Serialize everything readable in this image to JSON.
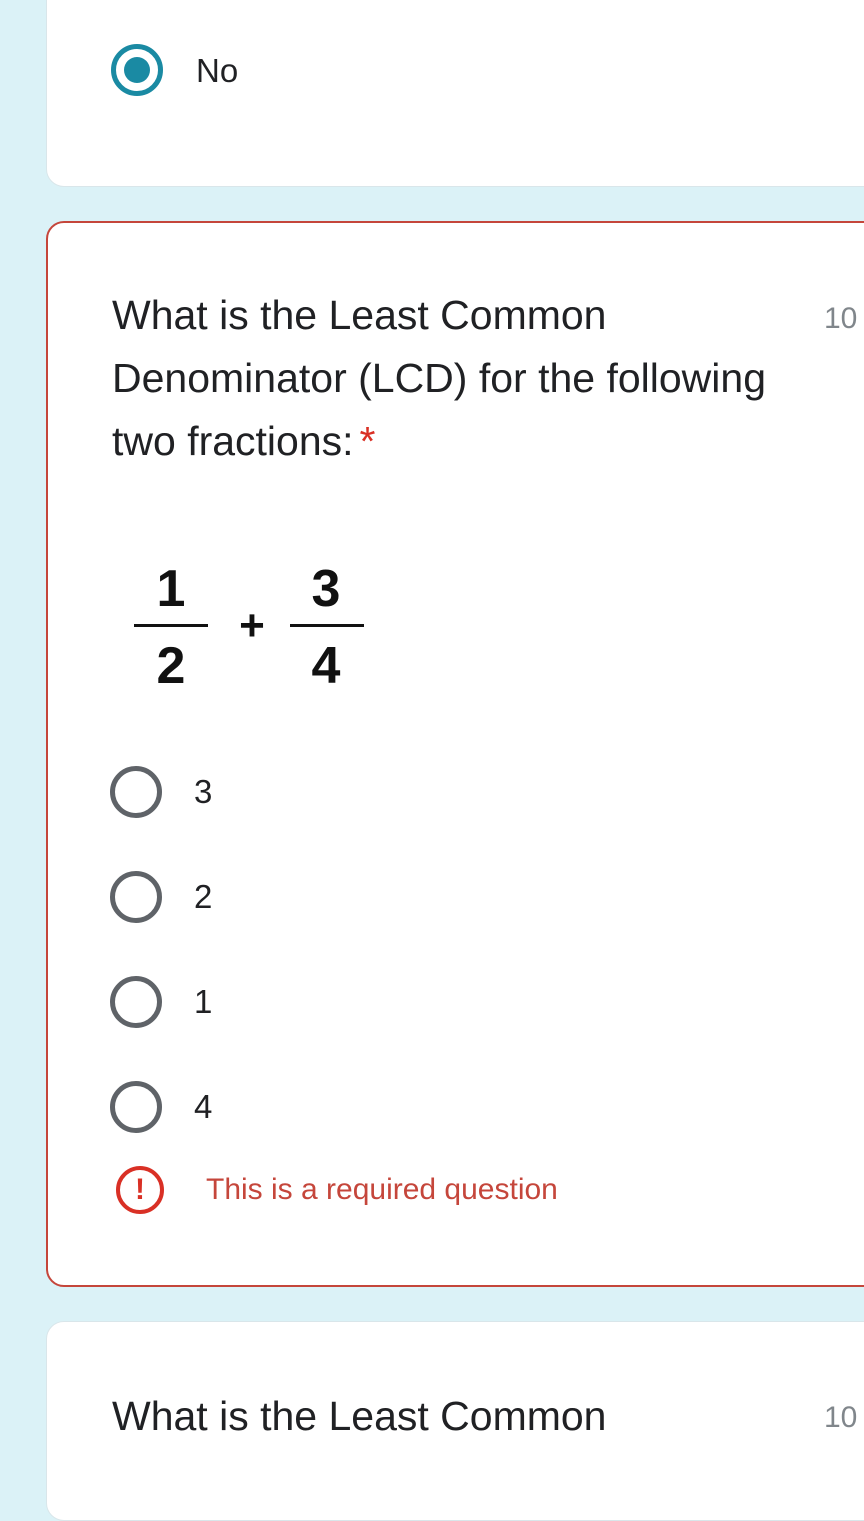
{
  "previous_question": {
    "selected_option": "No"
  },
  "question": {
    "title": "What is the Least Common Denominator (LCD) for the following two fractions:",
    "required_marker": "*",
    "points": "10",
    "expression": {
      "fraction1": {
        "numerator": "1",
        "denominator": "2"
      },
      "operator": "+",
      "fraction2": {
        "numerator": "3",
        "denominator": "4"
      }
    },
    "options": [
      "3",
      "2",
      "1",
      "4"
    ],
    "error_text": "This is a required question",
    "error_icon": "!"
  },
  "next_question": {
    "title": "What is the Least Common",
    "points": "10"
  },
  "colors": {
    "accent": "#1a8aa3",
    "error": "#d93025",
    "background": "#dbf2f7"
  }
}
